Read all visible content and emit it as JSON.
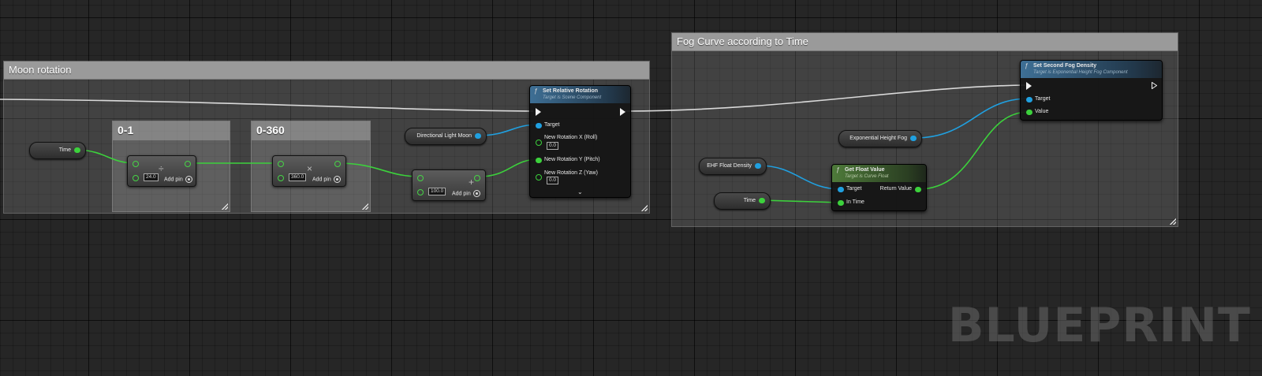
{
  "watermark": "BLUEPRINT",
  "colors": {
    "exec_wire": "#d9d9d9",
    "object_pin": "#20a0e0",
    "float_pin": "#3cd13c"
  },
  "comments": {
    "moon": {
      "title": "Moon rotation"
    },
    "fog": {
      "title": "Fog Curve according to Time"
    },
    "range_01": {
      "title": "0-1"
    },
    "range_360": {
      "title": "0-360"
    }
  },
  "variables": {
    "time_moon": "Time",
    "directional_light_moon": "Directional Light Moon",
    "exp_height_fog": "Exponential Height Fog",
    "ehf_float_density": "EHF Float Density",
    "time_fog": "Time"
  },
  "math_nodes": {
    "divide": {
      "op": "÷",
      "value": "24.0",
      "add_pin": "Add pin"
    },
    "multiply": {
      "op": "×",
      "value": "360.0",
      "add_pin": "Add pin"
    },
    "add": {
      "op": "+",
      "value": "100.0",
      "add_pin": "Add pin"
    }
  },
  "set_relative_rotation": {
    "icon": "function-icon",
    "title": "Set Relative Rotation",
    "subtitle": "Target is Scene Component",
    "pins": {
      "target": "Target",
      "roll": "New Rotation X (Roll)",
      "roll_value": "0.0",
      "pitch": "New Rotation Y (Pitch)",
      "yaw": "New Rotation Z (Yaw)",
      "yaw_value": "0.0"
    }
  },
  "set_second_fog_density": {
    "icon": "function-icon",
    "title": "Set Second Fog Density",
    "subtitle": "Target is Exponential Height Fog Component",
    "pins": {
      "target": "Target",
      "value": "Value"
    }
  },
  "get_float_value": {
    "icon": "function-icon",
    "title": "Get Float Value",
    "subtitle": "Target is Curve Float",
    "pins": {
      "target": "Target",
      "return_value": "Return Value",
      "in_time": "In Time"
    }
  }
}
